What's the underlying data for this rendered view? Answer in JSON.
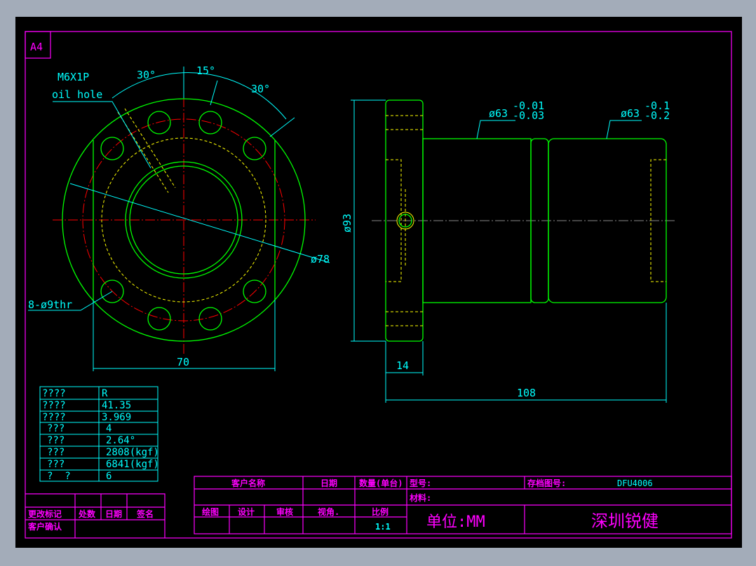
{
  "sheet": {
    "size_label": "A4"
  },
  "front_view": {
    "thread_label": "M6X1P",
    "oil_hole_label": "oil hole",
    "angle_1": "30°",
    "angle_2": "15°",
    "angle_3": "30°",
    "pcd_label": "ø78",
    "holes_label": "8-ø9thr",
    "width_dim": "70"
  },
  "side_view": {
    "dia_flange": "ø93",
    "dia_1": "ø63",
    "dia_1_tol_upper": "-0.01",
    "dia_1_tol_lower": "-0.03",
    "dia_2": "ø63",
    "dia_2_tol_upper": "-0.1",
    "dia_2_tol_lower": "-0.2",
    "flange_thickness": "14",
    "length": "108"
  },
  "spec_table": {
    "rows": [
      {
        "label": "????",
        "value": "R"
      },
      {
        "label": "????",
        "value": "41.35"
      },
      {
        "label": "????",
        "value": "3.969"
      },
      {
        "label": "???",
        "value": "4"
      },
      {
        "label": "???",
        "value": "2.64°"
      },
      {
        "label": "???",
        "value": "2808(kgf)"
      },
      {
        "label": "???",
        "value": "6841(kgf)"
      },
      {
        "label": "?  ?",
        "value": "6"
      }
    ]
  },
  "revision_table": {
    "change_mark": "更改标记",
    "count": "处数",
    "date": "日期",
    "signature": "签名",
    "customer_confirm": "客户确认"
  },
  "title_block": {
    "customer_name": "客户名称",
    "date": "日期",
    "quantity": "数量(单台)",
    "model": "型号:",
    "archive_no_label": "存档图号:",
    "archive_no": "DFU4006",
    "material": "材料:",
    "drawn": "绘图",
    "design": "设计",
    "review": "审核",
    "view_angle": "视角.",
    "scale_label": "比例",
    "scale": "1:1",
    "unit": "单位:MM",
    "company": "深圳锐健"
  },
  "colors": {
    "background": "#000000",
    "frame": "#ff00ff",
    "outline": "#00ff00",
    "dimension": "#00ffff",
    "center": "#ff0000",
    "hidden": "#ffff00"
  }
}
